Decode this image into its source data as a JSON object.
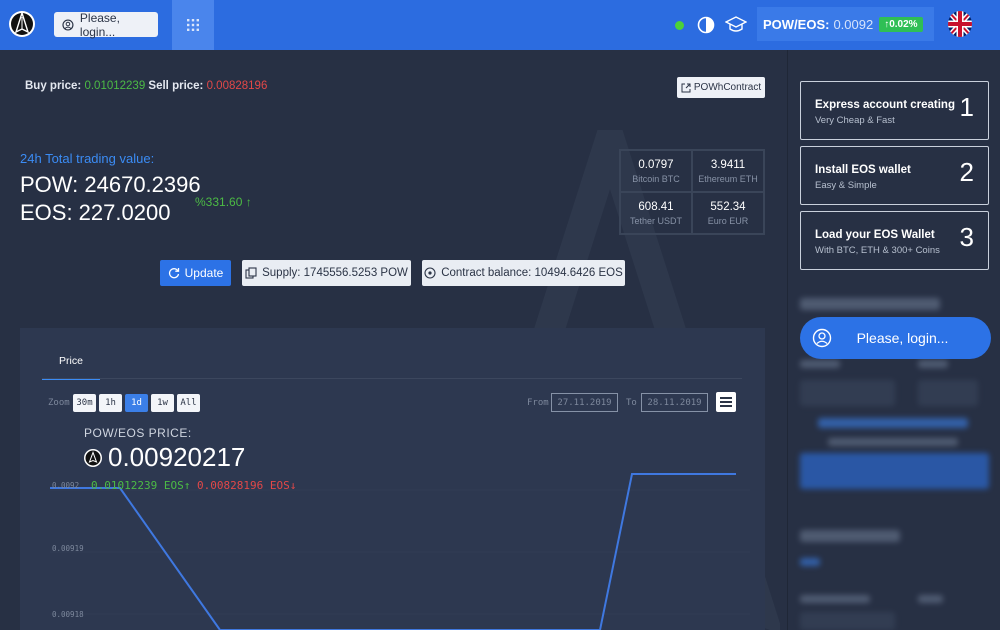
{
  "header": {
    "login_label": "Please, login...",
    "pair_label": "POW/EOS:",
    "pair_value": "0.0092",
    "pair_change": "↑0.02%",
    "icons": [
      "logo-icon",
      "user-icon",
      "grid-icon",
      "status-dot",
      "contrast-icon",
      "graduation-cap-icon",
      "uk-flag-icon"
    ]
  },
  "prices": {
    "buy_label": "Buy price:",
    "buy_value": "0.01012239",
    "sell_label": "Sell price:",
    "sell_value": "0.00828196"
  },
  "contract_button": "POWhContract",
  "totals": {
    "label": "24h Total trading value:",
    "pow": "POW: 24670.2396",
    "eos": "EOS: 227.0200",
    "change": "%331.60 ↑"
  },
  "rates": [
    {
      "value": "0.0797",
      "name": "Bitcoin BTC"
    },
    {
      "value": "3.9411",
      "name": "Ethereum ETH"
    },
    {
      "value": "608.41",
      "name": "Tether USDT"
    },
    {
      "value": "552.34",
      "name": "Euro EUR"
    }
  ],
  "actions": {
    "update": "Update",
    "supply": "Supply: 1745556.5253 POW",
    "balance": "Contract balance: 10494.6426 EOS"
  },
  "chart_panel": {
    "tab": "Price",
    "zoom_label": "Zoom",
    "zoom_options": [
      "30m",
      "1h",
      "1d",
      "1w",
      "All"
    ],
    "zoom_selected": "1d",
    "from_label": "From",
    "from_value": "27.11.2019",
    "to_label": "To",
    "to_value": "28.11.2019",
    "title": "POW/EOS PRICE:",
    "price": "0.00920217",
    "buy": "0.01012239 EOS↑",
    "sell": "0.00828196 EOS↓",
    "y_labels": [
      "0.0092",
      "0.00919",
      "0.00918"
    ]
  },
  "sidebar": {
    "steps": [
      {
        "title": "Express account creating",
        "subtitle": "Very Cheap & Fast",
        "num": "1"
      },
      {
        "title": "Install EOS wallet",
        "subtitle": "Easy & Simple",
        "num": "2"
      },
      {
        "title": "Load your EOS Wallet",
        "subtitle": "With BTC, ETH & 300+ Coins",
        "num": "3"
      }
    ],
    "login_label": "Please, login..."
  },
  "colors": {
    "header_bg": "#2c6ce0",
    "accent": "#3b8cf5",
    "buy": "#4cbb45",
    "sell": "#e24848",
    "page_bg": "#273044"
  }
}
